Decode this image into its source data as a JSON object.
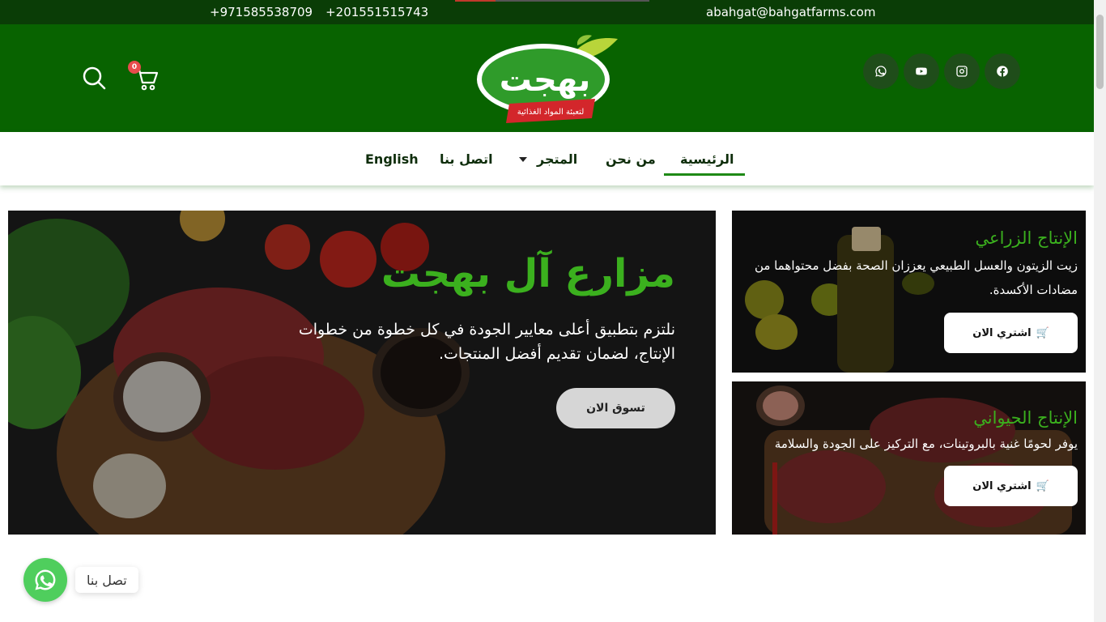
{
  "topbar": {
    "phone1": "+971585538709",
    "phone2": "+201551515743",
    "email": "abahgat@bahgatfarms.com"
  },
  "header": {
    "logo_main": "بهجت",
    "logo_sub": "لتعبئة المواد الغذائية",
    "cart_count": "0",
    "social_icons": [
      "whatsapp-icon",
      "youtube-icon",
      "instagram-icon",
      "facebook-icon"
    ]
  },
  "nav": {
    "home": "الرئيسية",
    "about": "من نحن",
    "store": "المتجر",
    "contact": "اتصل بنا",
    "english": "English"
  },
  "hero": {
    "title": "مزارع آل بهجت",
    "text": "نلتزم بتطبيق أعلى معايير الجودة في كل خطوة من خطوات الإنتاج، لضمان تقديم أفضل المنتجات.",
    "button": "تسوق الان"
  },
  "cards": [
    {
      "title": "الإنتاج الزراعي",
      "text": "زيت الزيتون والعسل الطبيعي يعززان الصحة بفضل محتواهما من مضادات الأكسدة.",
      "button": "اشتري الان"
    },
    {
      "title": "الإنتاج الحيواني",
      "text": "يوفر لحومًا غنية بالبروتينات، مع التركيز على الجودة والسلامة",
      "button": "اشتري الان"
    }
  ],
  "whatsapp": {
    "label": "تصل بنا"
  },
  "colors": {
    "header_green": "#086300",
    "topbar_dark": "#0a3d06",
    "accent_green": "#3bb01e"
  }
}
